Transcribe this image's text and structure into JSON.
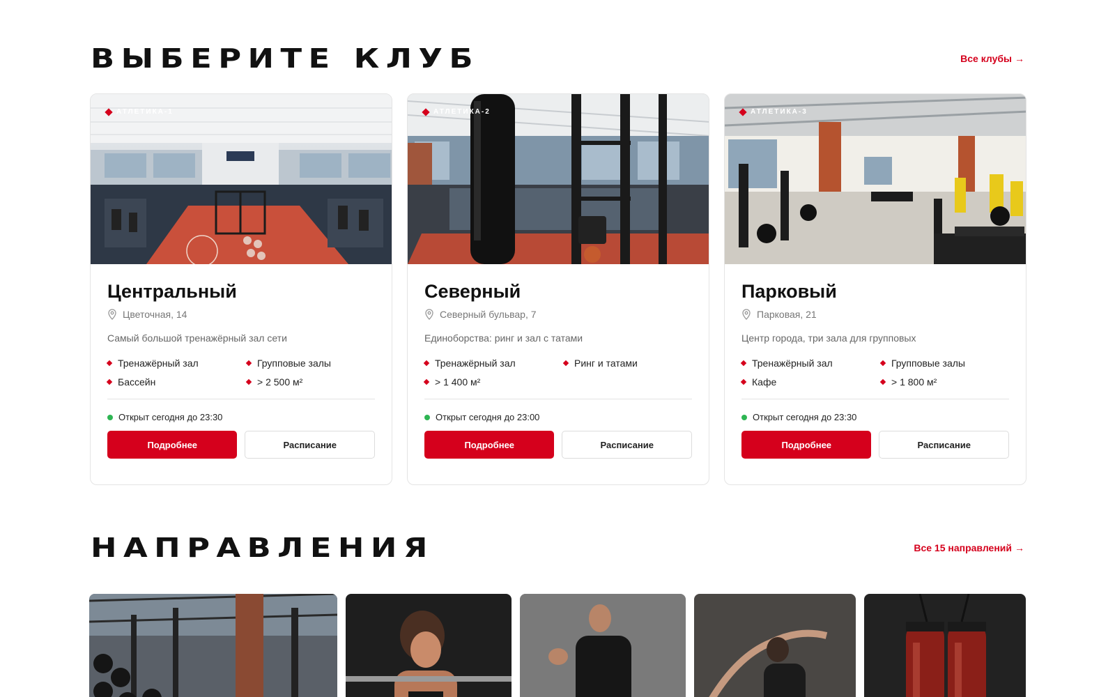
{
  "clubs_section": {
    "title": "Выберите клуб",
    "see_all": "Все клубы",
    "arrow": "→"
  },
  "clubs": [
    {
      "tag": "АТЛЕТИКА-1",
      "name": "Центральный",
      "address": "Цветочная, 14",
      "description": "Самый большой тренажёрный зал сети",
      "features": [
        "Тренажёрный зал",
        "Групповые залы",
        "Бассейн",
        "> 2 500 м²"
      ],
      "status": "Открыт сегодня до 23:30",
      "btn_more": "Подробнее",
      "btn_schedule": "Расписание"
    },
    {
      "tag": "АТЛЕТИКА-2",
      "name": "Северный",
      "address": "Северный бульвар, 7",
      "description": "Единоборства: ринг и зал с татами",
      "features": [
        "Тренажёрный зал",
        "Ринг и татами",
        "> 1 400 м²"
      ],
      "status": "Открыт сегодня до 23:00",
      "btn_more": "Подробнее",
      "btn_schedule": "Расписание"
    },
    {
      "tag": "АТЛЕТИКА-3",
      "name": "Парковый",
      "address": "Парковая, 21",
      "description": "Центр города, три зала для групповых",
      "features": [
        "Тренажёрный зал",
        "Групповые залы",
        "Кафе",
        "> 1 800 м²"
      ],
      "status": "Открыт сегодня до 23:30",
      "btn_more": "Подробнее",
      "btn_schedule": "Расписание"
    }
  ],
  "directions_section": {
    "title": "Направления",
    "see_all": "Все 15 направлений",
    "arrow": "→"
  },
  "directions": [
    {
      "image": "gym-dumbbells-photo"
    },
    {
      "image": "woman-barbell-photo"
    },
    {
      "image": "man-running-photo"
    },
    {
      "image": "woman-stretching-photo"
    },
    {
      "image": "boxing-gloves-photo"
    }
  ],
  "colors": {
    "accent": "#d5001c",
    "open_status": "#2eb553",
    "text": "#141414",
    "muted": "#777777",
    "border": "#e4e4e4"
  }
}
